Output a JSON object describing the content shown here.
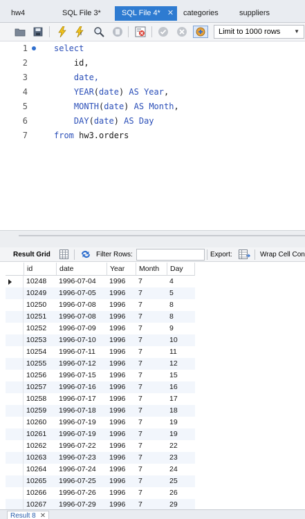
{
  "tabs": [
    {
      "label": "hw4",
      "active": false,
      "closable": false
    },
    {
      "label": "SQL File 3*",
      "active": false,
      "closable": false
    },
    {
      "label": "SQL File 4*",
      "active": true,
      "closable": true
    },
    {
      "label": "categories",
      "active": false,
      "closable": false
    },
    {
      "label": "suppliers",
      "active": false,
      "closable": false
    }
  ],
  "toolbar": {
    "limit_label": "Limit to 1000 rows",
    "icons": [
      "open-folder-icon",
      "save-icon",
      "execute-icon",
      "execute-current-icon",
      "explain-icon",
      "stop-icon",
      "toggle-error-icon",
      "commit-icon",
      "rollback-icon",
      "autocommit-icon"
    ]
  },
  "editor": {
    "lines": [
      {
        "num": "1",
        "tokens": [
          {
            "t": "select",
            "k": "kw"
          }
        ]
      },
      {
        "num": "2",
        "tokens": [
          {
            "t": "    id,",
            "k": "id"
          }
        ]
      },
      {
        "num": "3",
        "tokens": [
          {
            "t": "    date,",
            "k": "kw"
          }
        ]
      },
      {
        "num": "4",
        "tokens": [
          {
            "t": "    YEAR",
            "k": "fn"
          },
          {
            "t": "(",
            "k": "id"
          },
          {
            "t": "date",
            "k": "kw"
          },
          {
            "t": ") ",
            "k": "id"
          },
          {
            "t": "AS",
            "k": "kw"
          },
          {
            "t": " ",
            "k": "id"
          },
          {
            "t": "Year",
            "k": "kw"
          },
          {
            "t": ",",
            "k": "id"
          }
        ]
      },
      {
        "num": "5",
        "tokens": [
          {
            "t": "    MONTH",
            "k": "fn"
          },
          {
            "t": "(",
            "k": "id"
          },
          {
            "t": "date",
            "k": "kw"
          },
          {
            "t": ") ",
            "k": "id"
          },
          {
            "t": "AS",
            "k": "kw"
          },
          {
            "t": " ",
            "k": "id"
          },
          {
            "t": "Month",
            "k": "kw"
          },
          {
            "t": ",",
            "k": "id"
          }
        ]
      },
      {
        "num": "6",
        "tokens": [
          {
            "t": "    DAY",
            "k": "fn"
          },
          {
            "t": "(",
            "k": "id"
          },
          {
            "t": "date",
            "k": "kw"
          },
          {
            "t": ") ",
            "k": "id"
          },
          {
            "t": "AS",
            "k": "kw"
          },
          {
            "t": " ",
            "k": "id"
          },
          {
            "t": "Day",
            "k": "kw"
          }
        ]
      },
      {
        "num": "7",
        "tokens": [
          {
            "t": "from",
            "k": "kw"
          },
          {
            "t": " hw3.orders",
            "k": "id"
          }
        ]
      }
    ]
  },
  "result_toolbar": {
    "result_grid": "Result Grid",
    "filter_rows": "Filter Rows:",
    "export": "Export:",
    "wrap": "Wrap Cell Con"
  },
  "grid": {
    "columns": [
      "id",
      "date",
      "Year",
      "Month",
      "Day"
    ],
    "rows": [
      [
        "10248",
        "1996-07-04",
        "1996",
        "7",
        "4"
      ],
      [
        "10249",
        "1996-07-05",
        "1996",
        "7",
        "5"
      ],
      [
        "10250",
        "1996-07-08",
        "1996",
        "7",
        "8"
      ],
      [
        "10251",
        "1996-07-08",
        "1996",
        "7",
        "8"
      ],
      [
        "10252",
        "1996-07-09",
        "1996",
        "7",
        "9"
      ],
      [
        "10253",
        "1996-07-10",
        "1996",
        "7",
        "10"
      ],
      [
        "10254",
        "1996-07-11",
        "1996",
        "7",
        "11"
      ],
      [
        "10255",
        "1996-07-12",
        "1996",
        "7",
        "12"
      ],
      [
        "10256",
        "1996-07-15",
        "1996",
        "7",
        "15"
      ],
      [
        "10257",
        "1996-07-16",
        "1996",
        "7",
        "16"
      ],
      [
        "10258",
        "1996-07-17",
        "1996",
        "7",
        "17"
      ],
      [
        "10259",
        "1996-07-18",
        "1996",
        "7",
        "18"
      ],
      [
        "10260",
        "1996-07-19",
        "1996",
        "7",
        "19"
      ],
      [
        "10261",
        "1996-07-19",
        "1996",
        "7",
        "19"
      ],
      [
        "10262",
        "1996-07-22",
        "1996",
        "7",
        "22"
      ],
      [
        "10263",
        "1996-07-23",
        "1996",
        "7",
        "23"
      ],
      [
        "10264",
        "1996-07-24",
        "1996",
        "7",
        "24"
      ],
      [
        "10265",
        "1996-07-25",
        "1996",
        "7",
        "25"
      ],
      [
        "10266",
        "1996-07-26",
        "1996",
        "7",
        "26"
      ],
      [
        "10267",
        "1996-07-29",
        "1996",
        "7",
        "29"
      ]
    ]
  },
  "bottom_tab": {
    "label": "Result 8"
  },
  "colors": {
    "accent": "#2e7bd1",
    "keyword": "#2b4fb8",
    "alt_row": "#f2f6fc"
  }
}
